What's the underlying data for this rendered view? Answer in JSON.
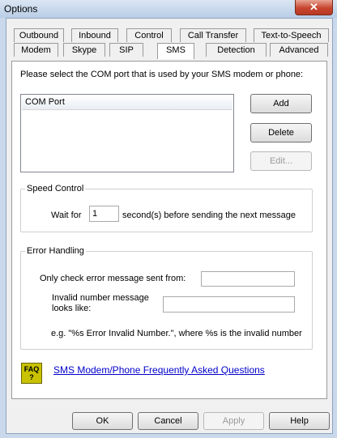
{
  "window": {
    "title": "Options",
    "close_glyph": "✕"
  },
  "tabs": {
    "row1": [
      "Outbound",
      "Inbound",
      "Control",
      "Call Transfer",
      "Text-to-Speech"
    ],
    "row2": [
      "Modem",
      "Skype",
      "SIP",
      "SMS",
      "Detection",
      "Advanced"
    ],
    "active": "SMS"
  },
  "sms": {
    "instruction": "Please select the COM port that is used by your SMS modem or phone:",
    "list_header": "COM Port",
    "buttons": {
      "add": "Add",
      "delete": "Delete",
      "edit": "Edit..."
    },
    "speed": {
      "title": "Speed Control",
      "wait_label": "Wait for",
      "wait_value": "1",
      "suffix": "second(s) before sending the next message"
    },
    "errors": {
      "title": "Error Handling",
      "check_from_label": "Only check error message sent from:",
      "check_from_value": "",
      "invalid_label_line1": "Invalid number message",
      "invalid_label_line2": "looks like:",
      "invalid_value": "",
      "example": "e.g. \"%s Error Invalid Number.\", where %s is the invalid number"
    },
    "faq": {
      "icon_top": "FAQ",
      "icon_bottom": "?",
      "link": "SMS Modem/Phone Frequently Asked Questions"
    }
  },
  "footer": {
    "ok": "OK",
    "cancel": "Cancel",
    "apply": "Apply",
    "help": "Help"
  }
}
